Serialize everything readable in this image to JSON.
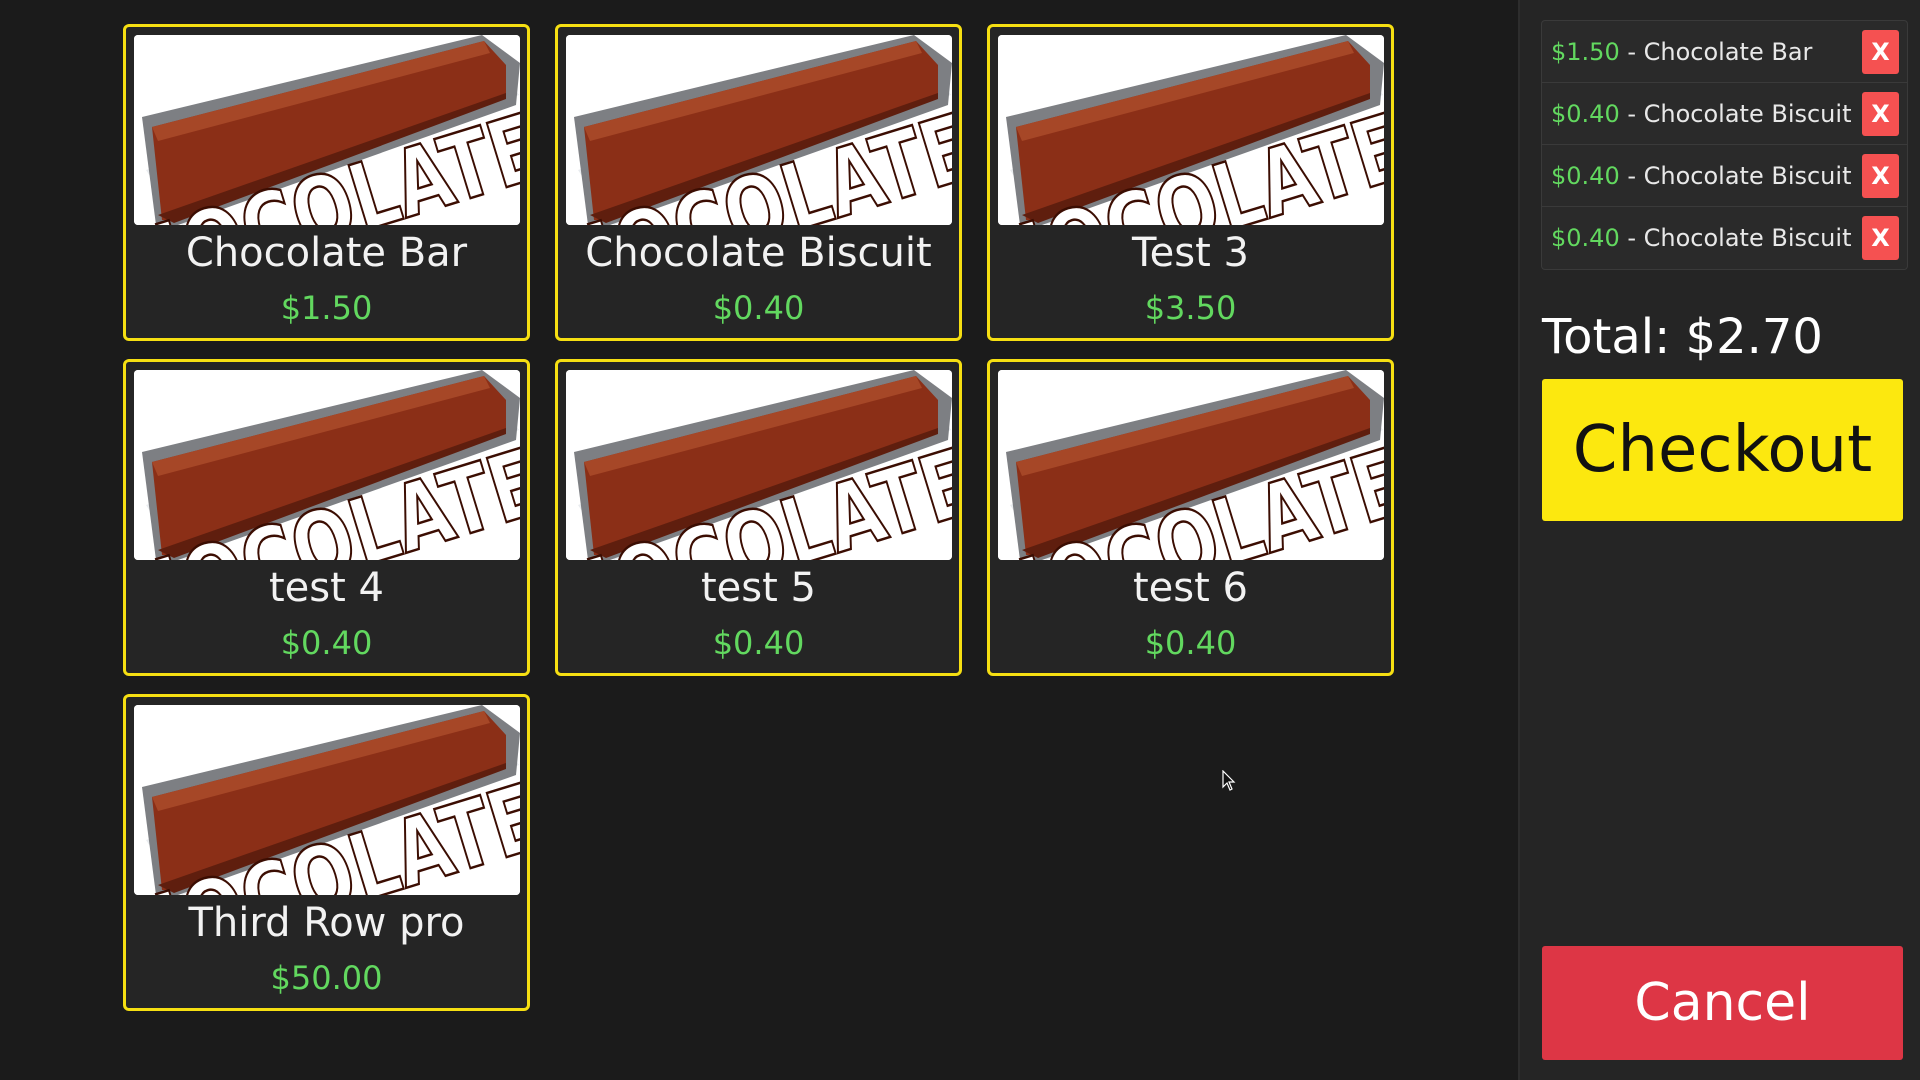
{
  "products": [
    {
      "name": "Chocolate Bar",
      "price": "$1.50",
      "image_text": "CHOCOLATE"
    },
    {
      "name": "Chocolate Biscuit",
      "price": "$0.40",
      "image_text": "CHOCOLATE"
    },
    {
      "name": "Test 3",
      "price": "$3.50",
      "image_text": "CHOCOLATE"
    },
    {
      "name": "test 4",
      "price": "$0.40",
      "image_text": "CHOCOLATE"
    },
    {
      "name": "test 5",
      "price": "$0.40",
      "image_text": "CHOCOLATE"
    },
    {
      "name": "test 6",
      "price": "$0.40",
      "image_text": "CHOCOLATE"
    },
    {
      "name": "Third Row pro",
      "price": "$50.00",
      "image_text": "CHOCOLATE"
    }
  ],
  "cart": {
    "separator": " - ",
    "remove_label": "X",
    "items": [
      {
        "price": "$1.50",
        "name": "Chocolate Bar"
      },
      {
        "price": "$0.40",
        "name": "Chocolate Biscuit"
      },
      {
        "price": "$0.40",
        "name": "Chocolate Biscuit"
      },
      {
        "price": "$0.40",
        "name": "Chocolate Biscuit"
      }
    ]
  },
  "total_label": "Total: $2.70",
  "checkout_label": "Checkout",
  "cancel_label": "Cancel",
  "colors": {
    "accent_border": "#f6df12",
    "price_green": "#62d85f",
    "checkout_yellow": "#fce80f",
    "cancel_red": "#dd3645",
    "remove_red": "#f55151",
    "background": "#1b1b1b"
  }
}
